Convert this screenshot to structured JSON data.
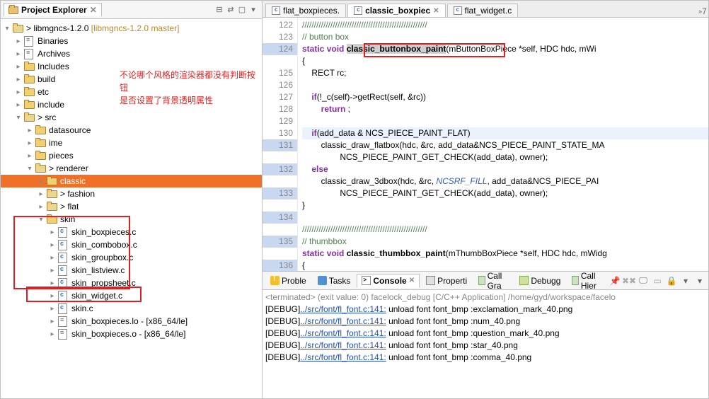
{
  "explorer": {
    "title": "Project Explorer",
    "root": {
      "label": "libmgncs-1.2.0",
      "version": "[libmgncs-1.2.0 master]"
    },
    "items": [
      {
        "label": "Binaries",
        "ico": "bin",
        "depth": 1,
        "tw": "▸"
      },
      {
        "label": "Archives",
        "ico": "bin",
        "depth": 1,
        "tw": "▸"
      },
      {
        "label": "Includes",
        "ico": "folder",
        "depth": 1,
        "tw": "▸"
      },
      {
        "label": "build",
        "ico": "folder",
        "depth": 1,
        "tw": "▸"
      },
      {
        "label": "etc",
        "ico": "folder",
        "depth": 1,
        "tw": "▸"
      },
      {
        "label": "include",
        "ico": "folder",
        "depth": 1,
        "tw": "▸"
      },
      {
        "label": "src",
        "ico": "folder gt",
        "depth": 1,
        "tw": "▾",
        "prefix": "> "
      },
      {
        "label": "datasource",
        "ico": "folder",
        "depth": 2,
        "tw": "▸"
      },
      {
        "label": "ime",
        "ico": "folder",
        "depth": 2,
        "tw": "▸"
      },
      {
        "label": "pieces",
        "ico": "folder",
        "depth": 2,
        "tw": "▸"
      },
      {
        "label": "renderer",
        "ico": "folder gt",
        "depth": 2,
        "tw": "▾",
        "prefix": "> "
      },
      {
        "label": "classic",
        "ico": "folder",
        "depth": 3,
        "tw": "▸",
        "sel": true
      },
      {
        "label": "fashion",
        "ico": "folder gt",
        "depth": 3,
        "tw": "▸",
        "prefix": "> "
      },
      {
        "label": "flat",
        "ico": "folder gt",
        "depth": 3,
        "tw": "▸",
        "prefix": "> "
      },
      {
        "label": "skin",
        "ico": "folder",
        "depth": 3,
        "tw": "▾"
      },
      {
        "label": "skin_boxpieces.c",
        "ico": "cfile",
        "depth": 4,
        "tw": "▸"
      },
      {
        "label": "skin_combobox.c",
        "ico": "cfile",
        "depth": 4,
        "tw": "▸"
      },
      {
        "label": "skin_groupbox.c",
        "ico": "cfile",
        "depth": 4,
        "tw": "▸"
      },
      {
        "label": "skin_listview.c",
        "ico": "cfile",
        "depth": 4,
        "tw": "▸"
      },
      {
        "label": "skin_propsheet.c",
        "ico": "cfile",
        "depth": 4,
        "tw": "▸"
      },
      {
        "label": "skin_widget.c",
        "ico": "cfile",
        "depth": 4,
        "tw": "▸"
      },
      {
        "label": "skin.c",
        "ico": "cfile",
        "depth": 4,
        "tw": "▸"
      },
      {
        "label": "skin_boxpieces.lo - [x86_64/le]",
        "ico": "bin",
        "depth": 4,
        "tw": "▸"
      },
      {
        "label": "skin_boxpieces.o - [x86_64/le]",
        "ico": "bin",
        "depth": 4,
        "tw": "▸"
      }
    ]
  },
  "annotation": {
    "line1": "不论哪个风格的渲染器都没有判断按钮",
    "line2": "是否设置了背景透明属性"
  },
  "editor": {
    "tabs": [
      {
        "label": "flat_boxpieces."
      },
      {
        "label": "classic_boxpiec",
        "active": true
      },
      {
        "label": "flat_widget.c"
      }
    ],
    "first_line": 122
  },
  "bottom": {
    "tabs": [
      {
        "label": "Proble",
        "ico": "probl"
      },
      {
        "label": "Tasks",
        "ico": "task"
      },
      {
        "label": "Console",
        "ico": "cons",
        "active": true
      },
      {
        "label": "Properti",
        "ico": "prop"
      },
      {
        "label": "Call Gra",
        "ico": "call"
      },
      {
        "label": "Debugg",
        "ico": "dbg"
      },
      {
        "label": "Call Hier",
        "ico": "call"
      }
    ],
    "termination": "<terminated> (exit value: 0) facelock_debug [C/C++ Application] /home/gyd/workspace/facelo",
    "lines": [
      {
        "pre": "[DEBUG]",
        "link": "../src/font/fl_font.c:141:",
        "post": " unload font font_bmp :exclamation_mark_40.png"
      },
      {
        "pre": "[DEBUG]",
        "link": "../src/font/fl_font.c:141:",
        "post": " unload font font_bmp :num_40.png"
      },
      {
        "pre": "[DEBUG]",
        "link": "../src/font/fl_font.c:141:",
        "post": " unload font font_bmp :question_mark_40.png"
      },
      {
        "pre": "[DEBUG]",
        "link": "../src/font/fl_font.c:141:",
        "post": " unload font font_bmp :star_40.png"
      },
      {
        "pre": "[DEBUG]",
        "link": "../src/font/fl_font.c:141:",
        "post": " unload font font_bmp :comma_40.png"
      }
    ]
  }
}
